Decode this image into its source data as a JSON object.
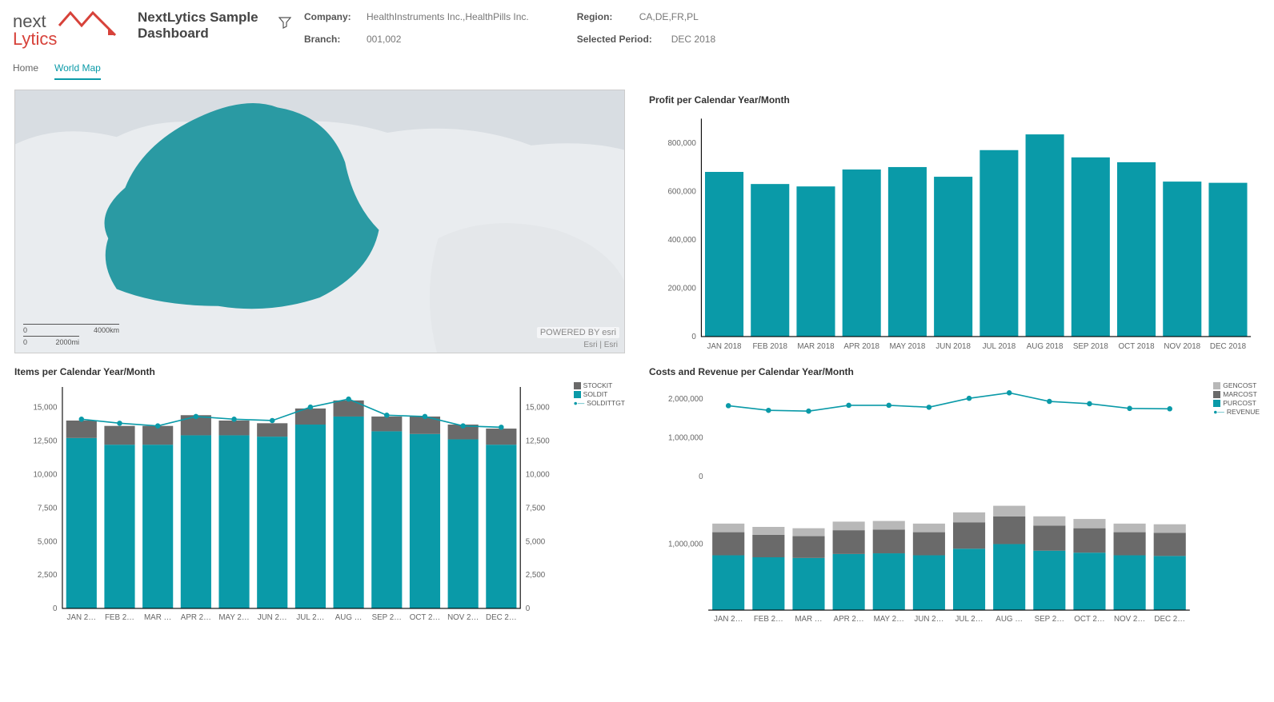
{
  "header": {
    "title": "NextLytics Sample Dashboard",
    "logo_line1": "next",
    "logo_line2": "Lytics"
  },
  "filters": {
    "company_label": "Company:",
    "company_value": "HealthInstruments Inc.,HealthPills Inc.",
    "branch_label": "Branch:",
    "branch_value": "001,002",
    "region_label": "Region:",
    "region_value": "CA,DE,FR,PL",
    "period_label": "Selected Period:",
    "period_value": "DEC 2018"
  },
  "tabs": {
    "home": "Home",
    "worldmap": "World Map"
  },
  "map": {
    "scale_km": "4000km",
    "scale_mi": "2000mi",
    "attr": "Esri | Esri",
    "esri_brand": "POWERED BY esri"
  },
  "chart_data": [
    {
      "id": "profit",
      "type": "bar",
      "title": "Profit per Calendar Year/Month",
      "categories": [
        "JAN 2018",
        "FEB 2018",
        "MAR 2018",
        "APR 2018",
        "MAY 2018",
        "JUN 2018",
        "JUL 2018",
        "AUG 2018",
        "SEP 2018",
        "OCT 2018",
        "NOV 2018",
        "DEC 2018"
      ],
      "values": [
        680000,
        630000,
        620000,
        690000,
        700000,
        660000,
        770000,
        835000,
        740000,
        720000,
        640000,
        635000
      ],
      "y_ticks": [
        0,
        200000,
        400000,
        600000,
        800000
      ],
      "ylim": [
        0,
        900000
      ]
    },
    {
      "id": "items",
      "type": "bar-line",
      "title": "Items per Calendar Year/Month",
      "categories": [
        "JAN 2…",
        "FEB 2…",
        "MAR …",
        "APR 2…",
        "MAY 2…",
        "JUN 2…",
        "JUL 2…",
        "AUG …",
        "SEP 2…",
        "OCT 2…",
        "NOV 2…",
        "DEC 2…"
      ],
      "series": [
        {
          "name": "SOLDIT",
          "type": "bar",
          "values": [
            12700,
            12200,
            12200,
            12900,
            12900,
            12800,
            13700,
            14300,
            13200,
            13000,
            12600,
            12200
          ]
        },
        {
          "name": "STOCKIT",
          "type": "bar-stack",
          "values": [
            1300,
            1400,
            1400,
            1500,
            1100,
            1000,
            1200,
            1200,
            1100,
            1300,
            1100,
            1200
          ]
        },
        {
          "name": "SOLDITTGT",
          "type": "line",
          "values": [
            14100,
            13800,
            13600,
            14300,
            14100,
            14000,
            15000,
            15600,
            14400,
            14300,
            13600,
            13500
          ]
        }
      ],
      "y_ticks": [
        0,
        2500,
        5000,
        7500,
        10000,
        12500,
        15000
      ],
      "ylim": [
        0,
        16500
      ],
      "legend": [
        "STOCKIT",
        "SOLDIT",
        "SOLDITTGT"
      ]
    },
    {
      "id": "costs",
      "type": "stacked-bar-line",
      "title": "Costs and Revenue per Calendar Year/Month",
      "categories": [
        "JAN 2…",
        "FEB 2…",
        "MAR …",
        "APR 2…",
        "MAY 2…",
        "JUN 2…",
        "JUL 2…",
        "AUG …",
        "SEP 2…",
        "OCT 2…",
        "NOV 2…",
        "DEC 2…"
      ],
      "series": [
        {
          "name": "PURCOST",
          "type": "bar",
          "values": [
            830000,
            800000,
            790000,
            850000,
            860000,
            830000,
            930000,
            1000000,
            900000,
            870000,
            830000,
            820000
          ]
        },
        {
          "name": "MARCOST",
          "type": "bar-stack",
          "values": [
            350000,
            340000,
            330000,
            360000,
            360000,
            350000,
            400000,
            420000,
            380000,
            370000,
            350000,
            350000
          ]
        },
        {
          "name": "GENCOST",
          "type": "bar-stack",
          "values": [
            130000,
            120000,
            120000,
            130000,
            130000,
            130000,
            150000,
            160000,
            140000,
            140000,
            130000,
            130000
          ]
        },
        {
          "name": "REVENUE",
          "type": "line",
          "values": [
            1820000,
            1700000,
            1680000,
            1830000,
            1830000,
            1780000,
            2010000,
            2150000,
            1930000,
            1870000,
            1750000,
            1740000
          ]
        }
      ],
      "top_y_ticks": [
        0,
        1000000,
        2000000
      ],
      "top_ylim": [
        -200000,
        2300000
      ],
      "bot_y_ticks": [
        1000000
      ],
      "bot_ylim": [
        0,
        1800000
      ],
      "legend": [
        "GENCOST",
        "MARCOST",
        "PURCOST",
        "REVENUE"
      ]
    }
  ]
}
